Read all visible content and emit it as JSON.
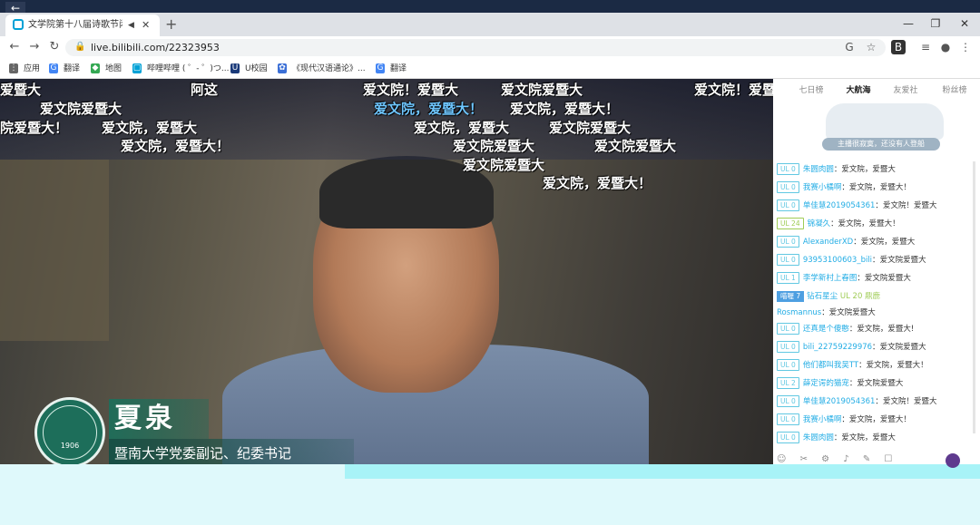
{
  "browser": {
    "tab_title": "文学院第十八届诗歌节闭幕式",
    "tab_audio_icon": "speaker-icon",
    "tab_close": "✕",
    "new_tab": "+",
    "window": {
      "minimize": "—",
      "restore": "❐",
      "close": "✕"
    },
    "url": "live.bilibili.com/22323953",
    "nav": {
      "back": "←",
      "forward": "→",
      "reload": "↻"
    },
    "bookmarks": [
      {
        "label": "应用",
        "icon": "apps-icon"
      },
      {
        "label": "翻译",
        "icon": "translate-icon"
      },
      {
        "label": "地图",
        "icon": "maps-icon"
      },
      {
        "label": "哔哩哔哩 ( ゜- ゜)つ...",
        "icon": "bilibili-icon"
      },
      {
        "label": "U校园",
        "icon": "u-campus-icon"
      },
      {
        "label": "《现代汉语通论》...",
        "icon": "paw-icon"
      },
      {
        "label": "翻译",
        "icon": "translate-icon"
      }
    ]
  },
  "danmaku": [
    {
      "text": "爱暨大",
      "color": "white"
    },
    {
      "text": "阿这",
      "color": "white"
    },
    {
      "text": "爱文院！爱暨大",
      "color": "white"
    },
    {
      "text": "爱文院爱暨大",
      "color": "white"
    },
    {
      "text": "爱文院！爱暨",
      "color": "white"
    },
    {
      "text": "爱文院爱暨大",
      "color": "white"
    },
    {
      "text": "爱文院，爱暨大！",
      "color": "blue"
    },
    {
      "text": "爱文院，爱暨大！",
      "color": "white"
    },
    {
      "text": "院爱暨大！",
      "color": "white"
    },
    {
      "text": "爱文院，爱暨大",
      "color": "white"
    },
    {
      "text": "爱文院，爱暨大",
      "color": "white"
    },
    {
      "text": "爱文院爱暨大",
      "color": "white"
    },
    {
      "text": "爱文院，爱暨大！",
      "color": "white"
    },
    {
      "text": "爱文院爱暨大",
      "color": "white"
    },
    {
      "text": "爱文院爱暨大",
      "color": "white"
    },
    {
      "text": "爱文院爱暨大",
      "color": "white"
    },
    {
      "text": "爱文院，爱暨大！",
      "color": "white"
    }
  ],
  "video": {
    "person_name": "夏泉",
    "person_title": "暨南大学党委副记、纪委书记",
    "logo_year": "1906"
  },
  "panel": {
    "tabs": [
      "七日榜",
      "大航海",
      "友爱社",
      "粉丝榜"
    ],
    "active_tab": "大航海",
    "empty_caption": "主播很寂寞，还没有人登船"
  },
  "chat": [
    {
      "level": "UL 0",
      "user": "朱圆肉圆",
      "msg": "爱文院，爱暨大"
    },
    {
      "level": "UL 0",
      "user": "我赛小橘啊",
      "msg": "爱文院，爱暨大！"
    },
    {
      "level": "UL 0",
      "user": "单佳慧2019054361",
      "msg": "爱文院！爱暨大"
    },
    {
      "level": "UL 24",
      "user": "锦凝久",
      "msg": "爱文院，爱暨大！"
    },
    {
      "level": "UL 0",
      "user": "AlexanderXD",
      "msg": "爱文院，爱暨大"
    },
    {
      "level": "UL 0",
      "user": "93953100603_bili",
      "msg": "爱文院爱暨大"
    },
    {
      "level": "UL 1",
      "user": "李学新村上春图",
      "msg": "爱文院爱暨大"
    },
    {
      "level": "喵喔 7",
      "user": "钻石星尘",
      "msg": "UL 20 鼎鹿"
    },
    {
      "level": "",
      "user": "Rosmannus",
      "msg": "爱文院爱暨大"
    },
    {
      "level": "UL 0",
      "user": "还真是个傻憨",
      "msg": "爱文院，爱暨大!"
    },
    {
      "level": "UL 0",
      "user": "bili_22759229976",
      "msg": "爱文院爱暨大"
    },
    {
      "level": "UL 0",
      "user": "他们都叫我吴TT",
      "msg": "爱文院，爱暨大！"
    },
    {
      "level": "UL 2",
      "user": "薛定谔的猫宠",
      "msg": "爱文院爱暨大"
    },
    {
      "level": "UL 0",
      "user": "单佳慧2019054361",
      "msg": "爱文院！爱暨大"
    },
    {
      "level": "UL 0",
      "user": "我赛小橘啊",
      "msg": "爱文院，爱暨大！"
    },
    {
      "level": "UL 0",
      "user": "朱圆肉圆",
      "msg": "爱文院，爱暨大"
    }
  ],
  "chat_tools": "☺ ✂ ⚙ ♪ ✎ ☐"
}
